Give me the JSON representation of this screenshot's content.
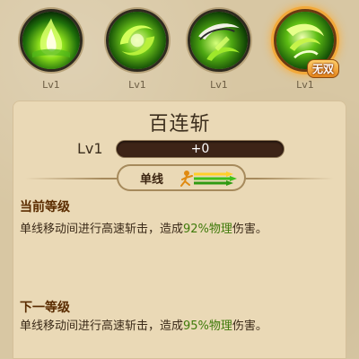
{
  "skills": [
    {
      "icon": "green-flame-skill-icon",
      "level": "Lv1",
      "selected": false
    },
    {
      "icon": "green-vortex-skill-icon",
      "level": "Lv1",
      "selected": false
    },
    {
      "icon": "green-blade-sweep-skill-icon",
      "level": "Lv1",
      "selected": false
    },
    {
      "icon": "green-swirl-ultimate-icon",
      "level": "Lv1",
      "selected": true,
      "badge": "无双"
    }
  ],
  "detail": {
    "title": "百连斩",
    "level_label": "Lv1",
    "exp_text": "+0",
    "exp_fraction": 0,
    "attack_type": "单线",
    "attack_icon": "single-line-attack-icon",
    "current": {
      "heading": "当前等级",
      "desc_prefix": "单线移动间进行高速斩击，造成",
      "desc_highlight": "92%物理",
      "desc_suffix": "伤害。"
    },
    "next": {
      "heading": "下一等级",
      "desc_prefix": "单线移动间进行高速斩击，造成",
      "desc_highlight": "95%物理",
      "desc_suffix": "伤害。"
    }
  },
  "colors": {
    "background": "#d8c7a3",
    "panel": "#ead9b6",
    "highlight_green": "#3f7a0a",
    "exp_bar_dark": "#3d2417",
    "selected_glow": "#f2a93a"
  }
}
